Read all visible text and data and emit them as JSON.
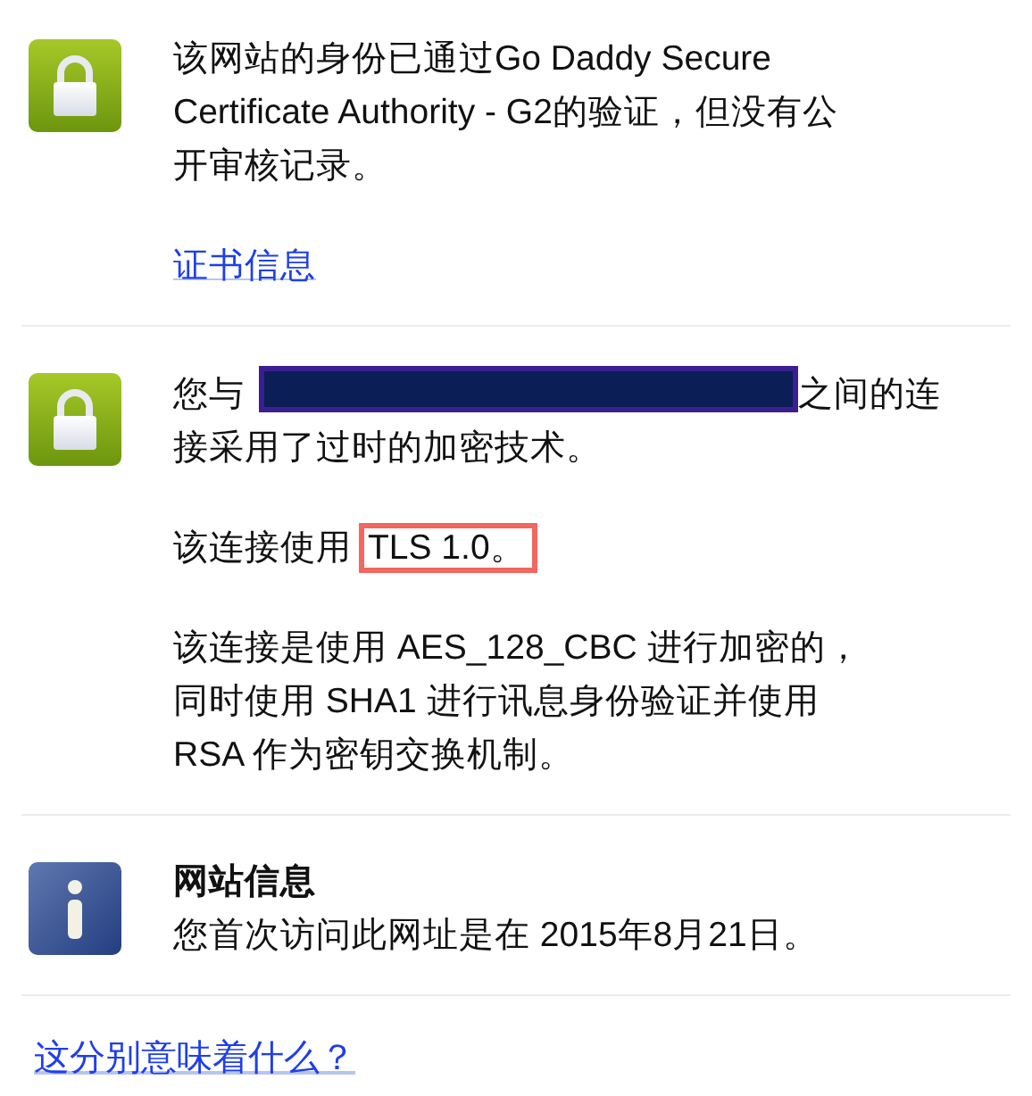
{
  "sections": [
    {
      "kind": "lock",
      "blocks": [
        {
          "kind": "text",
          "lines": [
            "该网站的身份已通过Go Daddy Secure",
            "Certificate Authority - G2的验证，但没有公",
            "开审核记录。"
          ]
        },
        {
          "kind": "link",
          "text": "证书信息"
        }
      ]
    },
    {
      "kind": "lock",
      "blocks": [
        {
          "kind": "redacted",
          "before": "您与",
          "after": [
            "之间的连",
            "接采用了过时的加密技术。"
          ]
        },
        {
          "kind": "highlight",
          "before": "该连接使用",
          "highlight": "TLS 1.0。"
        },
        {
          "kind": "text",
          "lines": [
            "该连接是使用 AES_128_CBC 进行加密的，",
            "同时使用 SHA1 进行讯息身份验证并使用",
            "RSA 作为密钥交换机制。"
          ]
        }
      ]
    },
    {
      "kind": "info",
      "blocks": [
        {
          "kind": "title",
          "text": "网站信息"
        },
        {
          "kind": "plain",
          "text": "您首次访问此网址是在 2015年8月21日。"
        }
      ]
    }
  ],
  "footer_link": "这分别意味着什么？"
}
